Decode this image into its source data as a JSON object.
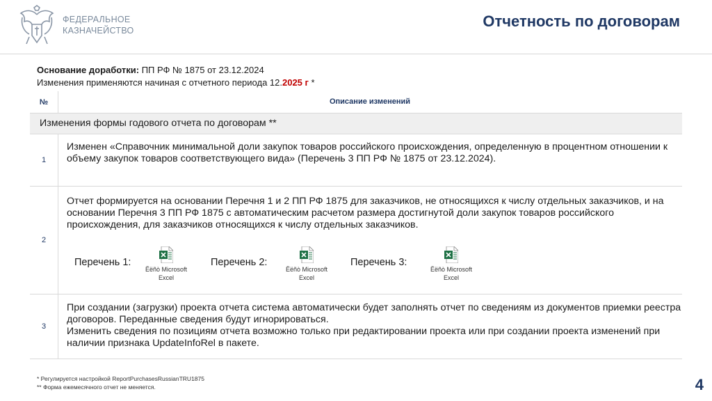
{
  "header": {
    "brand_line1": "ФЕДЕРАЛЬНОЕ",
    "brand_line2": "КАЗНАЧЕЙСТВО",
    "title": "Отчетность по договорам",
    "logo_icon": "double-headed-eagle-emblem-icon"
  },
  "basis": {
    "label": "Основание доработки:",
    "value": " ПП РФ № 1875 от 23.12.2024",
    "period_text": "Изменения применяются начиная с отчетного периода  12.",
    "period_highlight": "2025 г",
    "period_suffix": " *"
  },
  "table": {
    "col_num": "№",
    "col_desc": "Описание изменений",
    "section_title": "Изменения формы годового отчета по договорам **",
    "rows": [
      {
        "num": "1",
        "text": "Изменен «Справочник минимальной доли закупок товаров российского происхождения, определенную в процентном отношении к объему закупок товаров соответствующего вида» (Перечень 3 ПП РФ № 1875 от 23.12.2024)."
      },
      {
        "num": "2",
        "text": "Отчет формируется на основании Перечня 1 и 2 ПП РФ 1875 для заказчиков, не относящихся к числу отдельных заказчиков, и на основании Перечня 3 ПП РФ 1875 с автоматическим расчетом размера достигнутой доли закупок товаров российского происхождения, для заказчиков относящихся к числу отдельных заказчиков.",
        "attachments": [
          {
            "label": "Перечень 1:",
            "file_line1": "Ëëñò Microsoft",
            "file_line2": "Excel",
            "icon": "excel-file-icon"
          },
          {
            "label": "Перечень 2:",
            "file_line1": "Ëëñò Microsoft",
            "file_line2": "Excel",
            "icon": "excel-file-icon"
          },
          {
            "label": "Перечень 3:",
            "file_line1": "Ëëñò Microsoft",
            "file_line2": "Excel",
            "icon": "excel-file-icon"
          }
        ]
      },
      {
        "num": "3",
        "text_line1": "При создании (загрузки) проекта отчета система автоматически будет заполнять отчет по сведениям из документов приемки реестра договоров. Переданные сведения будут игнорироваться.",
        "text_line2": "Изменить сведения по позициям отчета возможно только при редактировании проекта или при создании проекта изменений при наличии признака UpdateInfoRel в пакете."
      }
    ]
  },
  "footnotes": {
    "note1": "* Регулируется настройкой ReportPurchasesRussianTRU1875",
    "note2": "** Форма ежемесячного отчет не меняется."
  },
  "page_number": "4",
  "colors": {
    "title": "#1f3864",
    "highlight": "#c00000",
    "excel_green": "#1e7145",
    "section_bg": "#efefef"
  }
}
